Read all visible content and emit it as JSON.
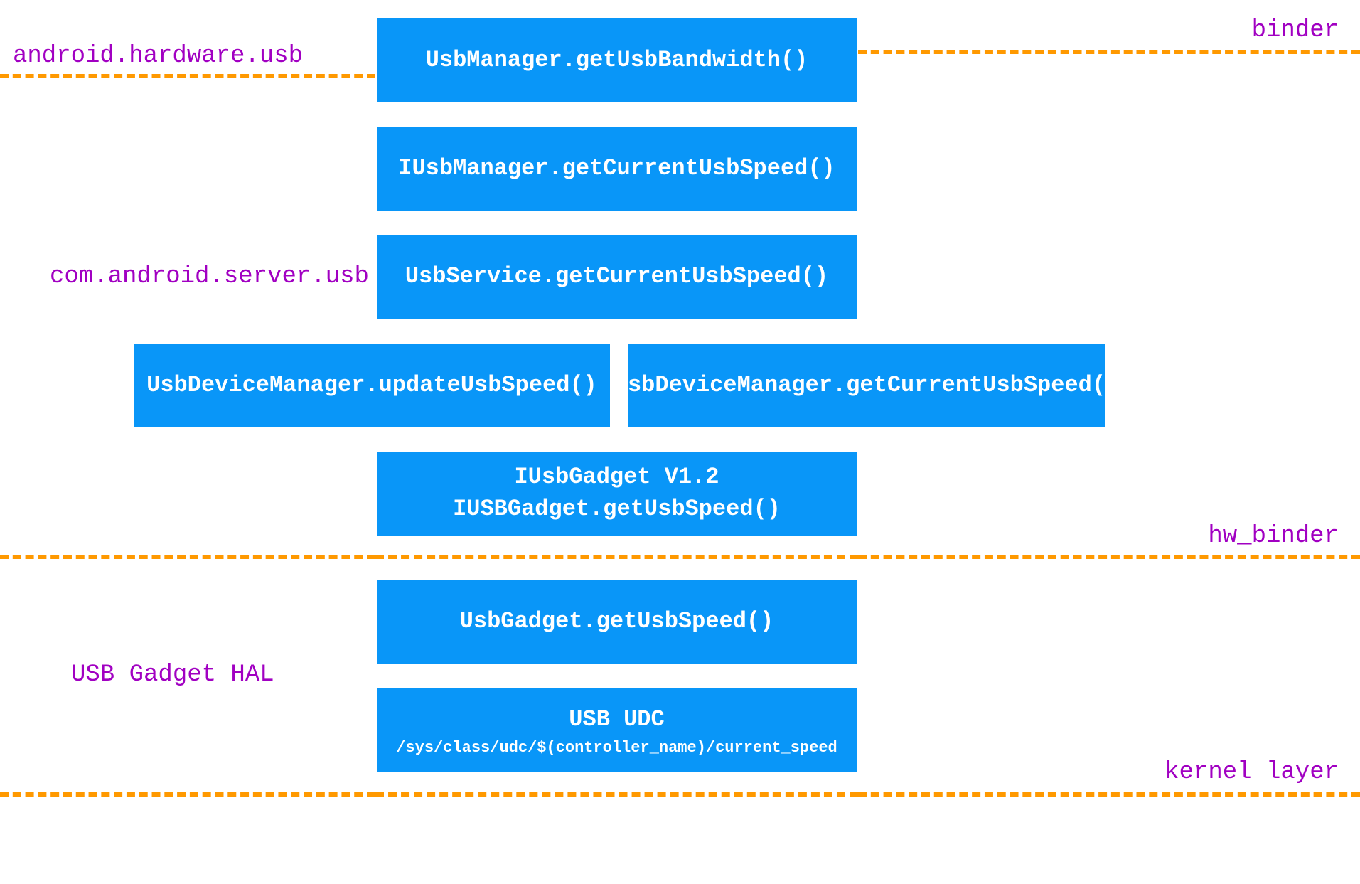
{
  "labels": {
    "category1": "android.hardware.usb",
    "category2": "com.android.server.usb",
    "category3": "USB Gadget HAL",
    "boundary1": "binder",
    "boundary2": "hw_binder",
    "boundary3": "kernel layer"
  },
  "boxes": {
    "b1": "UsbManager.getUsbBandwidth()",
    "b2": "IUsbManager.getCurrentUsbSpeed()",
    "b3": "UsbService.getCurrentUsbSpeed()",
    "b4a": "UsbDeviceManager.updateUsbSpeed()",
    "b4b": "UsbDeviceManager.getCurrentUsbSpeed()",
    "b5line1": "IUsbGadget V1.2",
    "b5line2": "IUSBGadget.getUsbSpeed()",
    "b6": "UsbGadget.getUsbSpeed()",
    "b7line1": "USB UDC",
    "b7line2": "/sys/class/udc/$(controller_name)/current_speed"
  }
}
